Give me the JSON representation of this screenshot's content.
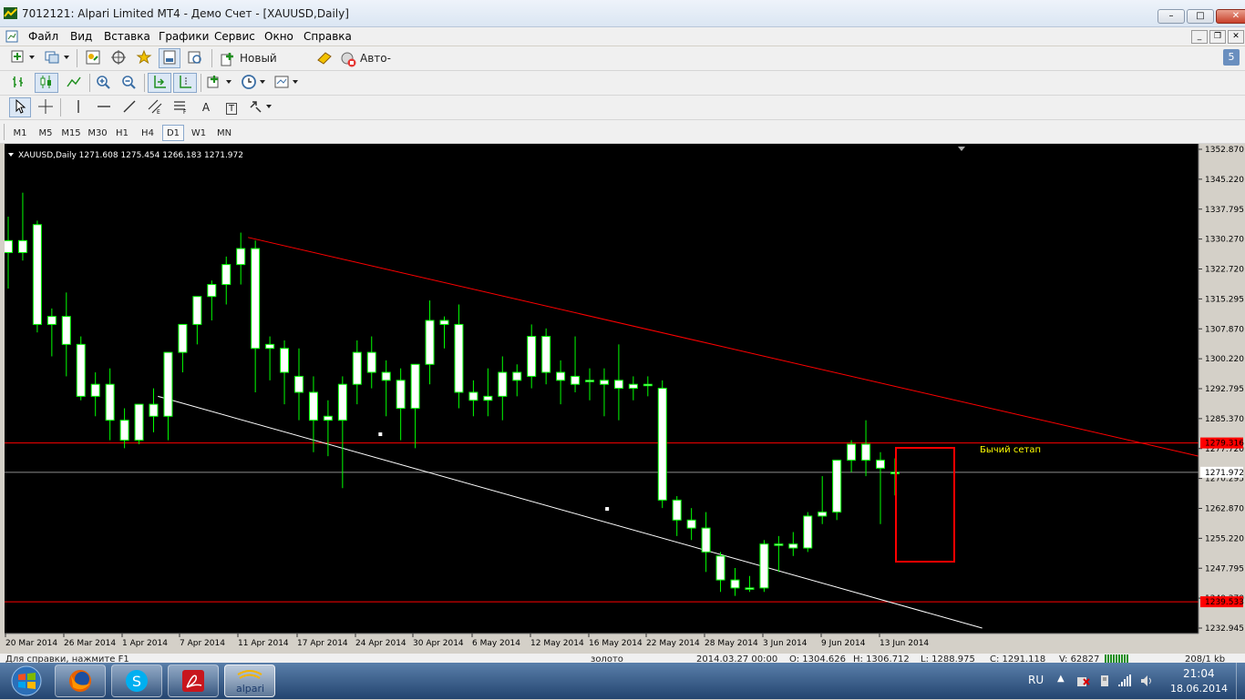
{
  "window": {
    "title": "7012121: Alpari Limited MT4 - Демо Счет - [XAUUSD,Daily]",
    "min": "–",
    "max": "□",
    "close": "✕"
  },
  "menu": [
    "Файл",
    "Вид",
    "Вставка",
    "Графики",
    "Сервис",
    "Окно",
    "Справка"
  ],
  "toolbar": {
    "new_order": "Новый Ордер",
    "auto_trading": "Авто-торговля",
    "search_placeholder": "",
    "badge": "5"
  },
  "draw_tools": {
    "text": "A",
    "text_label": "T"
  },
  "timeframes": [
    "M1",
    "M5",
    "M15",
    "M30",
    "H1",
    "H4",
    "D1",
    "W1",
    "MN"
  ],
  "active_timeframe": "D1",
  "chart": {
    "header": "XAUUSD,Daily  1271.608 1275.454 1266.183 1271.972",
    "annotation": "Бычий сетап",
    "price_labels": [
      "1352.870",
      "1345.220",
      "1337.795",
      "1330.270",
      "1322.720",
      "1315.295",
      "1307.870",
      "1300.220",
      "1292.795",
      "1285.370",
      "1277.720",
      "1270.295",
      "1262.870",
      "1255.220",
      "1247.795",
      "1240.370",
      "1232.945"
    ],
    "current_price": "1271.972",
    "resistance_label": "1279.316",
    "support_label": "1239.533",
    "date_labels": [
      "20 Mar 2014",
      "26 Mar 2014",
      "1 Apr 2014",
      "7 Apr 2014",
      "11 Apr 2014",
      "17 Apr 2014",
      "24 Apr 2014",
      "30 Apr 2014",
      "6 May 2014",
      "12 May 2014",
      "16 May 2014",
      "22 May 2014",
      "28 May 2014",
      "3 Jun 2014",
      "9 Jun 2014",
      "13 Jun 2014"
    ],
    "colors": {
      "bg": "#000000",
      "bull": "#ffffff",
      "bear": "#ffffff",
      "wick": "#00ff00",
      "resistance": "#ff0000",
      "trend_up": "#ffffff",
      "annotation": "#ffff00"
    }
  },
  "chart_data": {
    "type": "candlestick",
    "symbol": "XAUUSD",
    "timeframe": "Daily",
    "ylim": [
      1232.945,
      1352.87
    ],
    "candles": [
      [
        1327,
        1336,
        1318,
        1330
      ],
      [
        1330,
        1342,
        1325,
        1327
      ],
      [
        1334,
        1335,
        1307,
        1309
      ],
      [
        1309,
        1313,
        1301,
        1311
      ],
      [
        1311,
        1317,
        1296,
        1304
      ],
      [
        1304,
        1306,
        1290,
        1291
      ],
      [
        1291,
        1297,
        1286,
        1294
      ],
      [
        1294,
        1298,
        1280,
        1285
      ],
      [
        1285,
        1288,
        1278,
        1280
      ],
      [
        1280,
        1289,
        1279,
        1289
      ],
      [
        1289,
        1293,
        1282,
        1286
      ],
      [
        1286,
        1302,
        1280,
        1302
      ],
      [
        1302,
        1307,
        1297,
        1309
      ],
      [
        1309,
        1316,
        1304,
        1316
      ],
      [
        1316,
        1320,
        1310,
        1319
      ],
      [
        1319,
        1326,
        1314,
        1324
      ],
      [
        1324,
        1332,
        1319,
        1328
      ],
      [
        1328,
        1330,
        1292,
        1303
      ],
      [
        1303,
        1306,
        1295,
        1304
      ],
      [
        1303,
        1305,
        1289,
        1297
      ],
      [
        1296,
        1303,
        1285,
        1292
      ],
      [
        1292,
        1296,
        1277,
        1285
      ],
      [
        1286,
        1290,
        1276,
        1285
      ],
      [
        1285,
        1296,
        1268,
        1294
      ],
      [
        1294,
        1305,
        1289,
        1302
      ],
      [
        1302,
        1306,
        1293,
        1297
      ],
      [
        1297,
        1300,
        1286,
        1295
      ],
      [
        1295,
        1298,
        1280,
        1288
      ],
      [
        1288,
        1299,
        1278,
        1299
      ],
      [
        1299,
        1315,
        1294,
        1310
      ],
      [
        1310,
        1311,
        1303,
        1309
      ],
      [
        1309,
        1314,
        1288,
        1292
      ],
      [
        1292,
        1295,
        1286,
        1290
      ],
      [
        1290,
        1298,
        1286,
        1291
      ],
      [
        1291,
        1301,
        1285,
        1297
      ],
      [
        1297,
        1299,
        1291,
        1295
      ],
      [
        1296,
        1309,
        1293,
        1306
      ],
      [
        1306,
        1308,
        1294,
        1297
      ],
      [
        1297,
        1300,
        1289,
        1295
      ],
      [
        1296,
        1306,
        1292,
        1294
      ],
      [
        1295,
        1298,
        1290,
        1295
      ],
      [
        1295,
        1298,
        1286,
        1294
      ],
      [
        1295,
        1304,
        1285,
        1293
      ],
      [
        1294,
        1296,
        1290,
        1293
      ],
      [
        1294,
        1296,
        1291,
        1294
      ],
      [
        1293,
        1295,
        1263,
        1265
      ],
      [
        1265,
        1266,
        1256,
        1260
      ],
      [
        1260,
        1263,
        1255,
        1258
      ],
      [
        1258,
        1262,
        1247,
        1252
      ],
      [
        1251,
        1252,
        1242,
        1245
      ],
      [
        1245,
        1248,
        1241,
        1243
      ],
      [
        1243,
        1246,
        1242,
        1243
      ],
      [
        1243,
        1255,
        1242,
        1254
      ],
      [
        1254,
        1256,
        1247,
        1254
      ],
      [
        1254,
        1257,
        1251,
        1253
      ],
      [
        1253,
        1262,
        1252,
        1261
      ],
      [
        1261,
        1271,
        1259,
        1262
      ],
      [
        1262,
        1275,
        1260,
        1275
      ],
      [
        1275,
        1280,
        1272,
        1279
      ],
      [
        1279,
        1285,
        1271,
        1275
      ],
      [
        1275,
        1277,
        1259,
        1273
      ],
      [
        1271.608,
        1275.454,
        1266.183,
        1271.972
      ]
    ],
    "horizontal_lines": [
      1279.316,
      1271.972,
      1239.533
    ],
    "trendlines": [
      {
        "from": [
          1330.8,
          "11 Apr 2014"
        ],
        "to": [
          1276,
          "right edge"
        ]
      },
      {
        "from": [
          1291,
          "2 Apr 2014"
        ],
        "to": [
          1232.945,
          "13 Jun 2014"
        ]
      }
    ]
  },
  "status": {
    "help": "Для справки, нажмите F1",
    "profile": "золото",
    "datetime": "2014.03.27 00:00",
    "open": "O: 1304.626",
    "high": "H: 1306.712",
    "low": "L: 1288.975",
    "close": "C: 1291.118",
    "volume": "V: 62827",
    "traffic": "208/1 kb"
  },
  "taskbar": {
    "lang": "RU",
    "time": "21:04",
    "date": "18.06.2014",
    "alpari": "alpari"
  }
}
